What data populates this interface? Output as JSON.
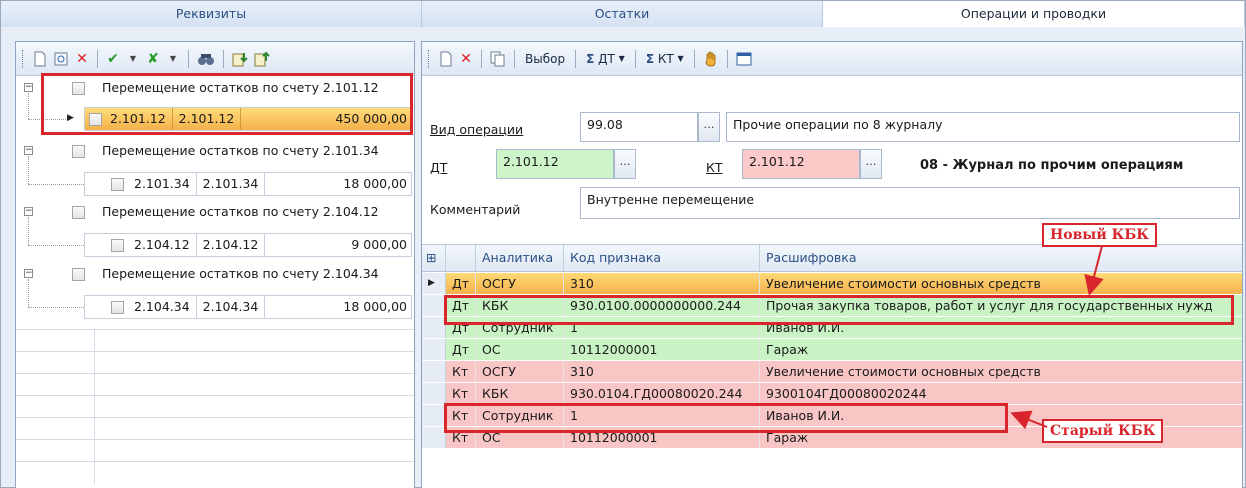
{
  "tabs": [
    {
      "label": "Реквизиты",
      "active": false
    },
    {
      "label": "Остатки",
      "active": false
    },
    {
      "label": "Операции и проводки",
      "active": true
    }
  ],
  "left_toolbar": {
    "icons": [
      "new-document-icon",
      "preview-icon",
      "delete-icon",
      "approve-icon",
      "unapprove-icon",
      "find-icon",
      "import-icon",
      "export-icon"
    ]
  },
  "tree": {
    "groups": [
      {
        "label": "Перемещение остатков по счету 2.101.12",
        "child": {
          "debit": "2.101.12",
          "credit": "2.101.12",
          "amount": "450 000,00",
          "selected": true
        }
      },
      {
        "label": "Перемещение остатков по счету 2.101.34",
        "child": {
          "debit": "2.101.34",
          "credit": "2.101.34",
          "amount": "18 000,00",
          "selected": false
        }
      },
      {
        "label": "Перемещение остатков по счету 2.104.12",
        "child": {
          "debit": "2.104.12",
          "credit": "2.104.12",
          "amount": "9 000,00",
          "selected": false
        }
      },
      {
        "label": "Перемещение остатков по счету 2.104.34",
        "child": {
          "debit": "2.104.34",
          "credit": "2.104.34",
          "amount": "18 000,00",
          "selected": false
        }
      }
    ]
  },
  "right_toolbar": {
    "select_label": "Выбор",
    "sum_dt_label": "ДТ",
    "sum_kt_label": "КТ"
  },
  "form": {
    "operation_type_label": "Вид операции",
    "operation_code": "99.08",
    "operation_name": "Прочие операции по 8 журналу",
    "dt_label": "ДТ",
    "dt_value": "2.101.12",
    "kt_label": "КТ",
    "kt_value": "2.101.12",
    "journal": "08 - Журнал по прочим операциям",
    "comment_label": "Комментарий",
    "comment_value": "Внутренне перемещение"
  },
  "grid": {
    "columns": [
      "",
      "Аналитика",
      "Код признака",
      "Расшифровка"
    ],
    "rows": [
      {
        "side": "Дт",
        "analytic": "ОСГУ",
        "code": "310",
        "description": "Увеличение стоимости основных средств",
        "style": "orange",
        "current": true
      },
      {
        "side": "Дт",
        "analytic": "КБК",
        "code": "930.0100.0000000000.244",
        "description": "Прочая закупка товаров, работ и услуг для государственных нужд",
        "style": "green",
        "current": false
      },
      {
        "side": "Дт",
        "analytic": "Сотрудник",
        "code": "1",
        "description": "Иванов И.И.",
        "style": "green",
        "current": false
      },
      {
        "side": "Дт",
        "analytic": "ОС",
        "code": "10112000001",
        "description": "Гараж",
        "style": "green",
        "current": false
      },
      {
        "side": "Кт",
        "analytic": "ОСГУ",
        "code": "310",
        "description": "Увеличение стоимости основных средств",
        "style": "pink",
        "current": false
      },
      {
        "side": "Кт",
        "analytic": "КБК",
        "code": "930.0104.ГД00080020.244",
        "description": "9300104ГД00080020244",
        "style": "pink",
        "current": false
      },
      {
        "side": "Кт",
        "analytic": "Сотрудник",
        "code": "1",
        "description": "Иванов И.И.",
        "style": "pink",
        "current": false
      },
      {
        "side": "Кт",
        "analytic": "ОС",
        "code": "10112000001",
        "description": "Гараж",
        "style": "pink",
        "current": false
      }
    ]
  },
  "annotations": {
    "new_kbk": "Новый КБК",
    "old_kbk": "Старый КБК"
  },
  "colors": {
    "annotation_red": "#d8262c",
    "debit_row": "#c9f3c5",
    "credit_row": "#f9c6c6",
    "selected_row": "#f5b24c"
  }
}
